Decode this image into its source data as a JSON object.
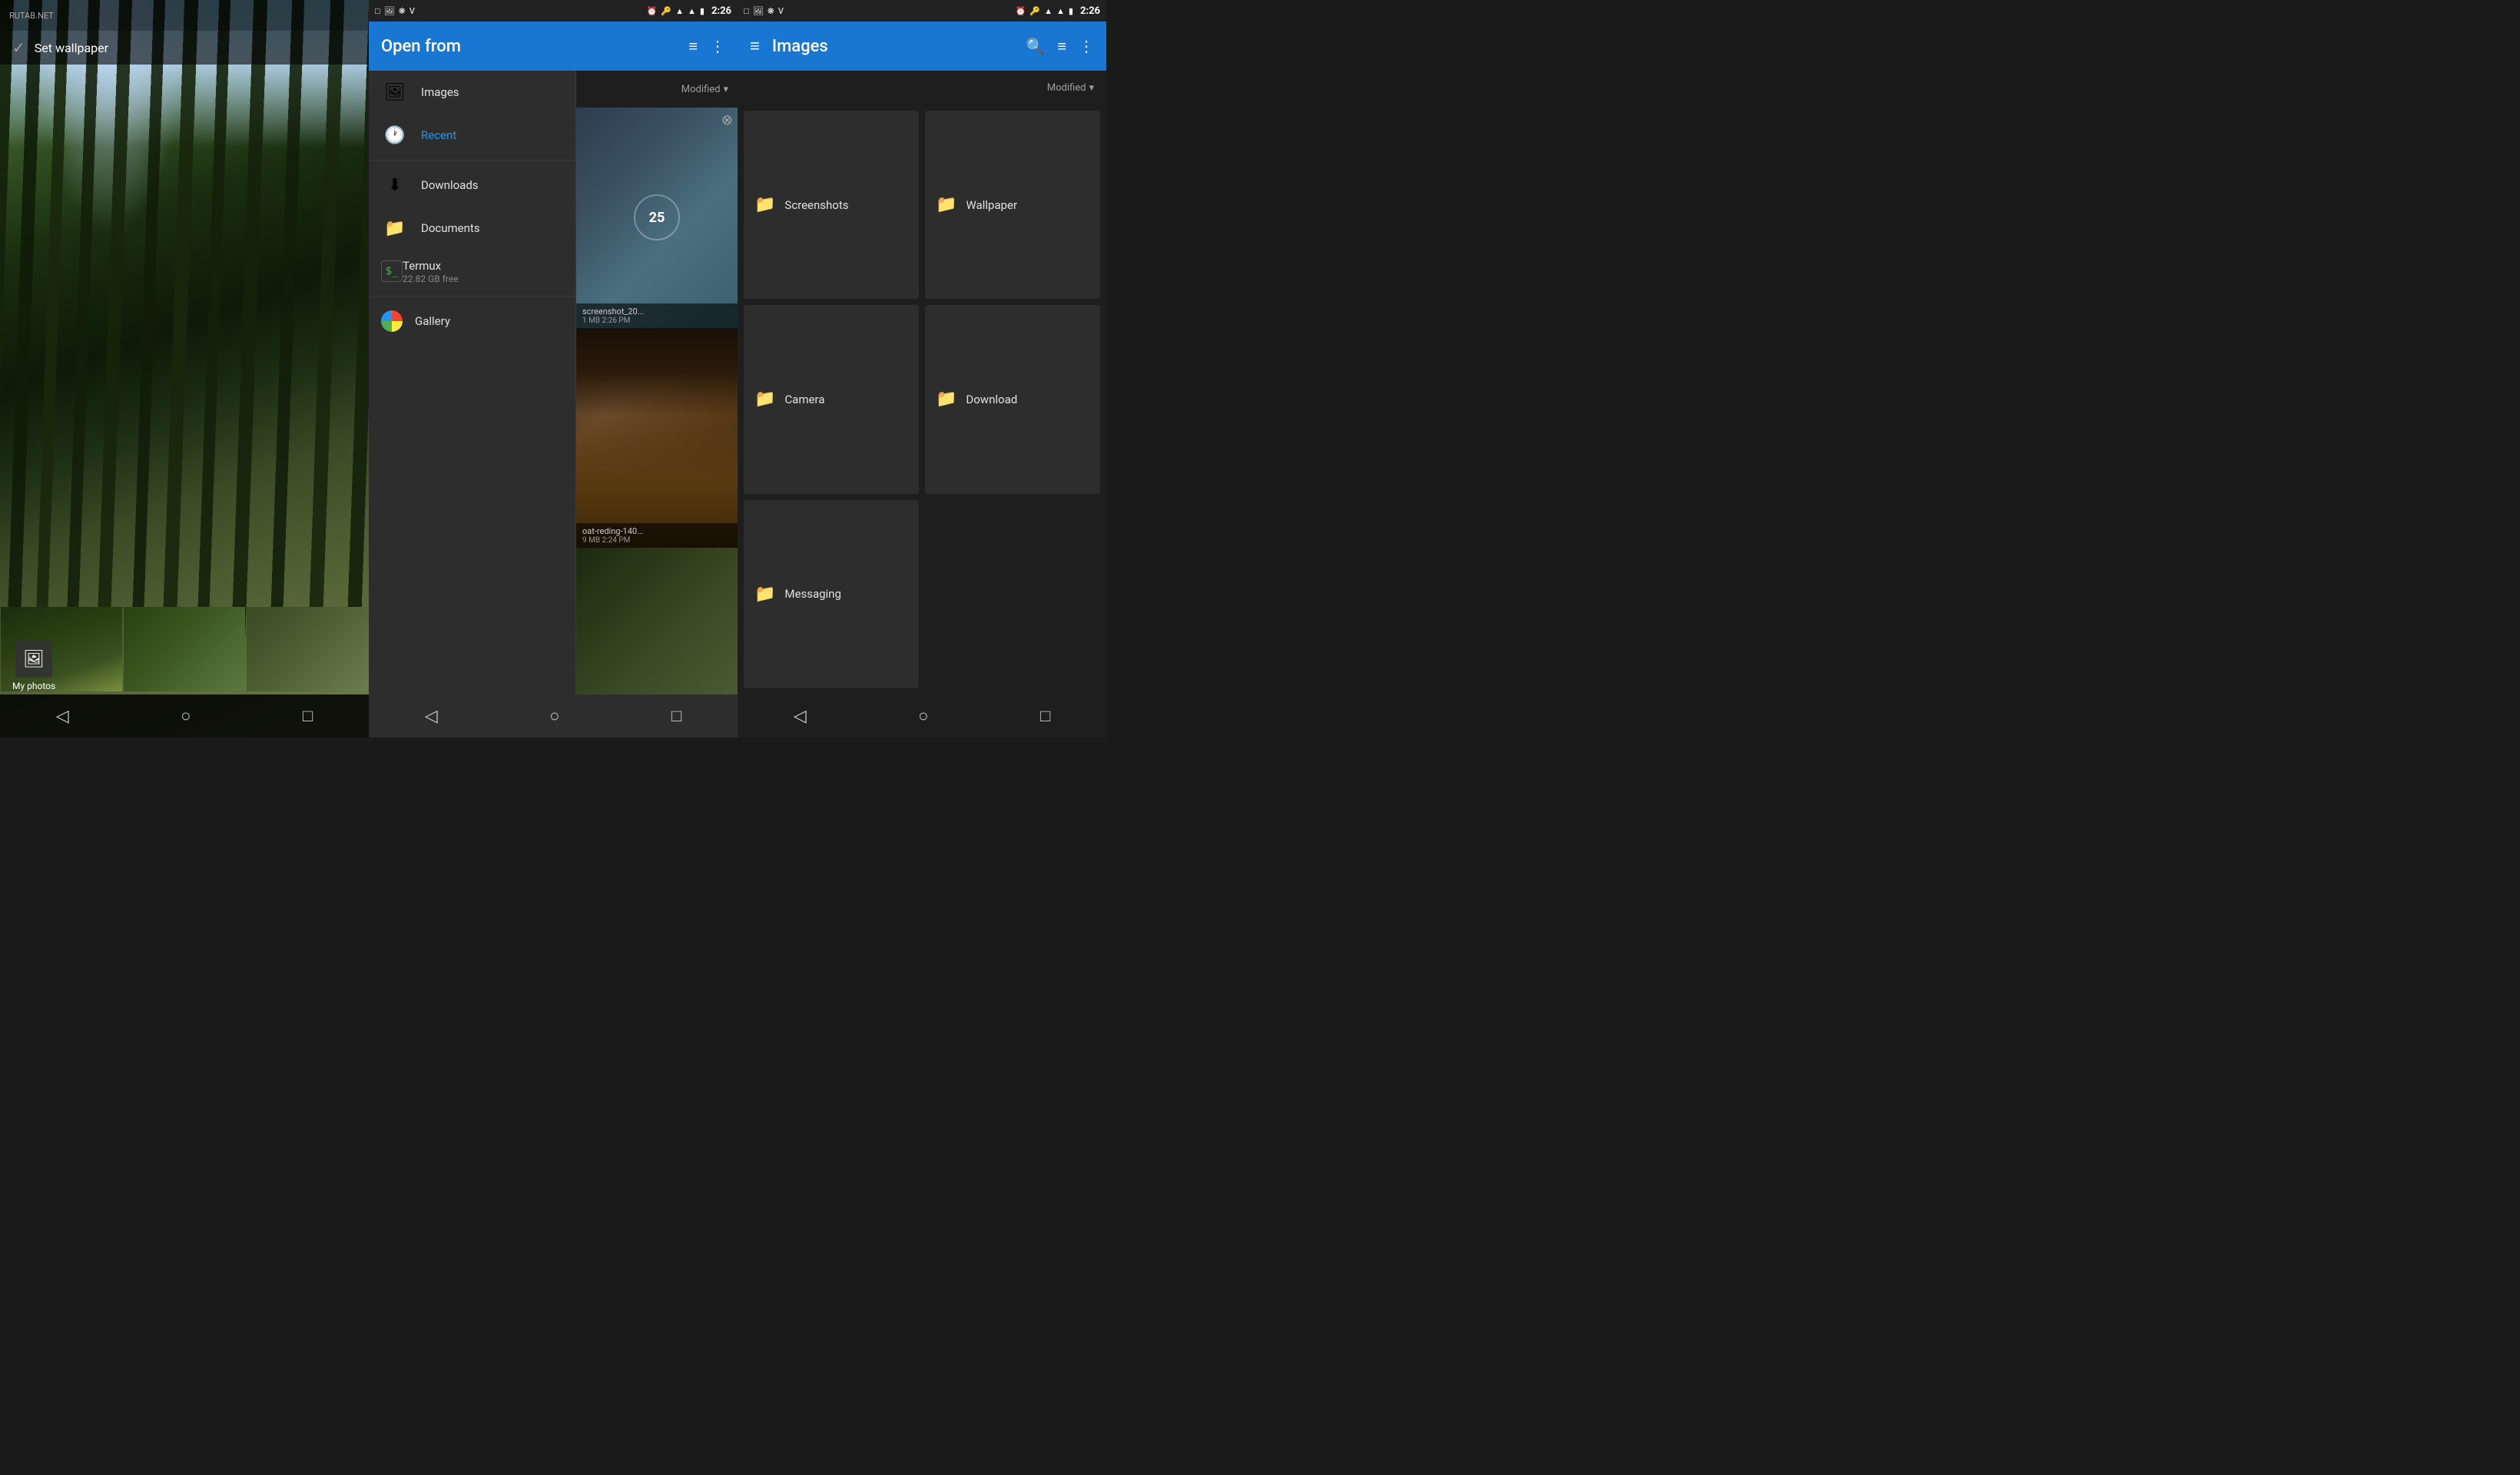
{
  "app": {
    "brand": "RUTAB.NET"
  },
  "panel1": {
    "set_wallpaper": "Set wallpaper",
    "my_photos": "My photos",
    "nav": {
      "back": "◁",
      "home": "○",
      "recent": "□"
    }
  },
  "panel2": {
    "status_left": [
      "□",
      "🖼",
      "❋",
      "V"
    ],
    "status_right_icons": [
      "⏰",
      "🔑",
      "📶",
      "🔋"
    ],
    "time": "2:26",
    "header_title": "Open from",
    "sort_label": "Modified",
    "drawer_items": [
      {
        "id": "images",
        "label": "Images",
        "icon": "🖼",
        "active": false
      },
      {
        "id": "recent",
        "label": "Recent",
        "icon": "🕐",
        "active": true
      },
      {
        "id": "downloads",
        "label": "Downloads",
        "icon": "⬇",
        "active": false
      },
      {
        "id": "documents",
        "label": "Documents",
        "icon": "📁",
        "active": false
      },
      {
        "id": "termux",
        "label": "Termux",
        "sublabel": "22.82 GB free",
        "icon": "termux",
        "active": false
      },
      {
        "id": "gallery",
        "label": "Gallery",
        "icon": "gallery",
        "active": false
      }
    ],
    "preview_images": [
      {
        "name": "screenshot_20...",
        "meta": "1 MB  2:26 PM"
      },
      {
        "name": "oat-reding-140...",
        "meta": "9 MB  2:24 PM"
      },
      {
        "name": "",
        "meta": ""
      }
    ],
    "nav": {
      "back": "◁",
      "home": "○",
      "recent": "□"
    }
  },
  "panel3": {
    "status_left": [
      "□",
      "🖼",
      "❋",
      "V"
    ],
    "time": "2:26",
    "header_title": "Images",
    "sort_label": "Modified",
    "folders": [
      {
        "id": "screenshots",
        "label": "Screenshots"
      },
      {
        "id": "wallpaper",
        "label": "Wallpaper"
      },
      {
        "id": "camera",
        "label": "Camera"
      },
      {
        "id": "download",
        "label": "Download"
      },
      {
        "id": "messaging",
        "label": "Messaging"
      }
    ],
    "nav": {
      "back": "◁",
      "home": "○",
      "recent": "□"
    }
  }
}
